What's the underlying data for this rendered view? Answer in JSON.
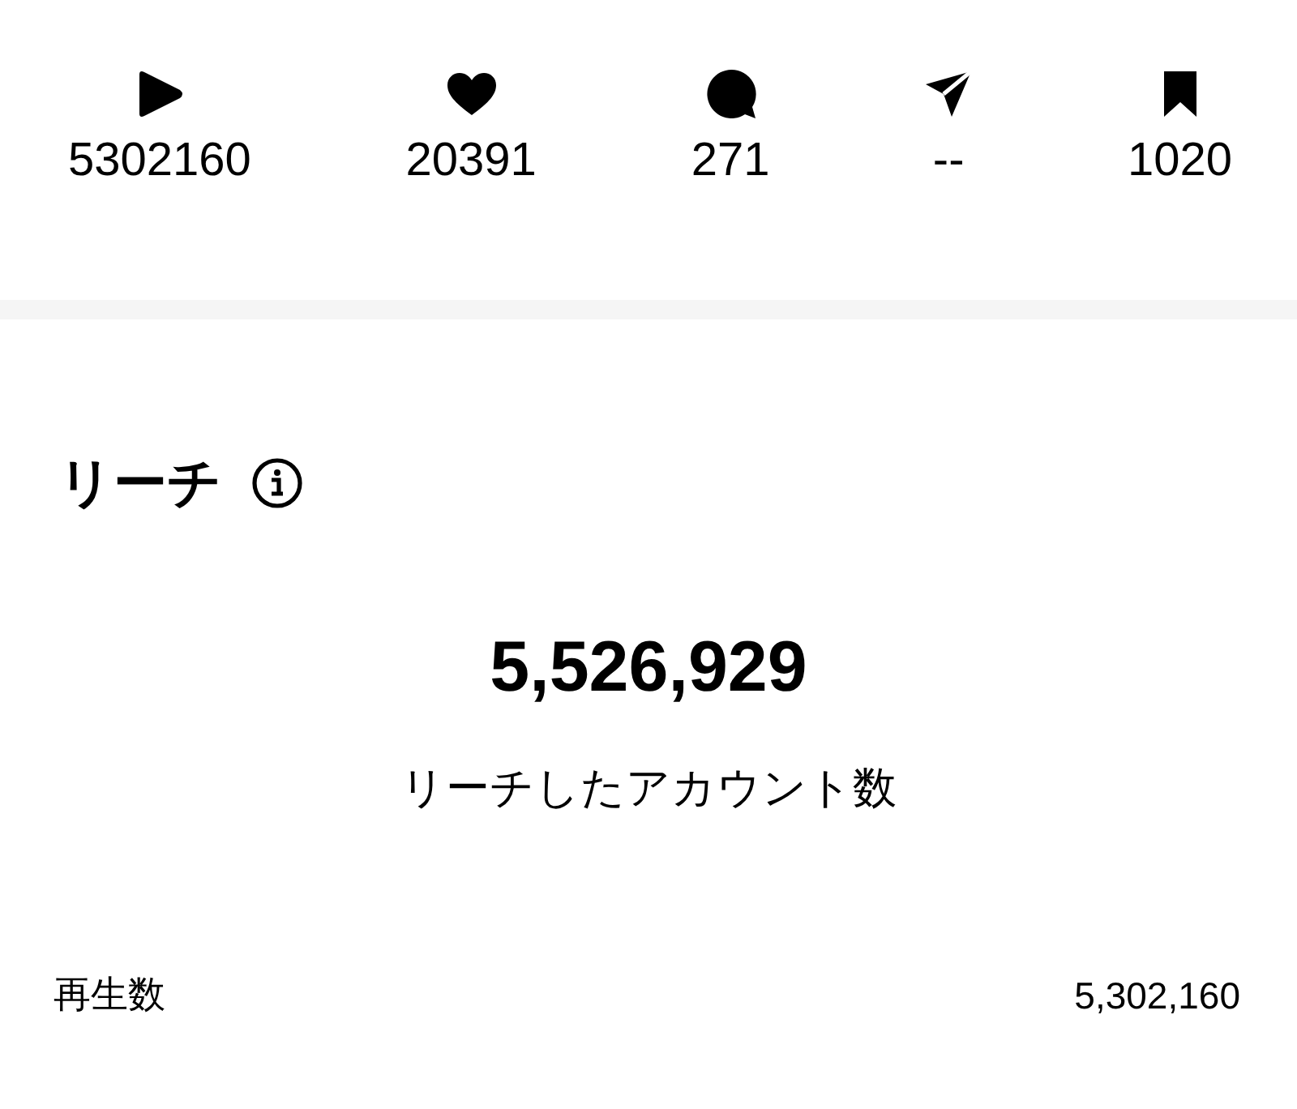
{
  "stats": [
    {
      "kind": "play",
      "value": "5302160"
    },
    {
      "kind": "heart",
      "value": "20391"
    },
    {
      "kind": "comment",
      "value": "271"
    },
    {
      "kind": "send",
      "value": "--"
    },
    {
      "kind": "bookmark",
      "value": "1020"
    }
  ],
  "reach": {
    "title": "リーチ",
    "total": "5,526,929",
    "total_label": "リーチしたアカウント数",
    "rows": [
      {
        "label": "再生数",
        "value": "5,302,160"
      }
    ]
  }
}
